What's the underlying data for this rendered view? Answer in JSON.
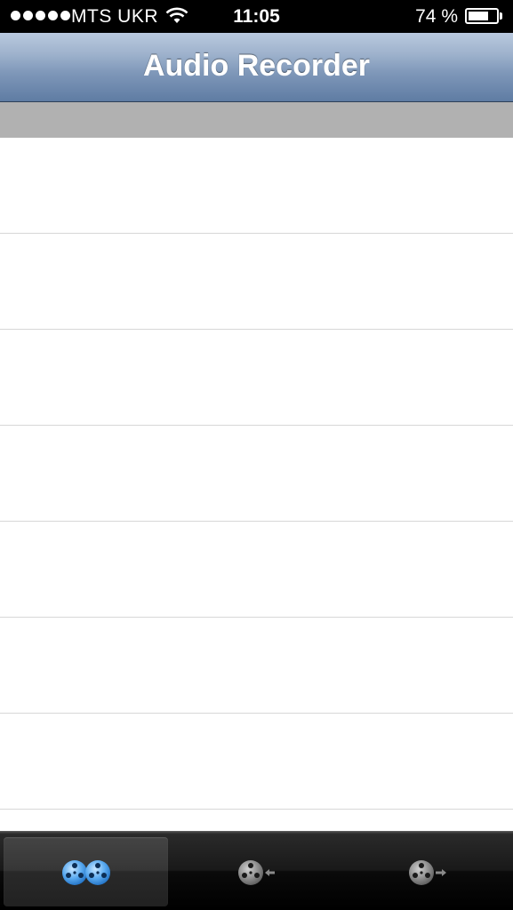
{
  "status_bar": {
    "carrier": "MTS UKR",
    "time": "11:05",
    "battery_percent_text": "74 %",
    "battery_level": 0.74,
    "signal_bars": 5,
    "wifi_icon": "wifi-icon"
  },
  "nav_bar": {
    "title": "Audio Recorder"
  },
  "table": {
    "rows": 7
  },
  "tab_bar": {
    "tabs": [
      {
        "icon": "reels-icon",
        "selected": true
      },
      {
        "icon": "reel-import-icon",
        "selected": false
      },
      {
        "icon": "reel-export-icon",
        "selected": false
      }
    ]
  },
  "colors": {
    "nav_gradient_top": "#b9c9de",
    "nav_gradient_bottom": "#5f7ca3",
    "section_header": "#b1b1b1",
    "selected_icon": "#5aaaf0",
    "unselected_icon": "#8a8a8a"
  }
}
